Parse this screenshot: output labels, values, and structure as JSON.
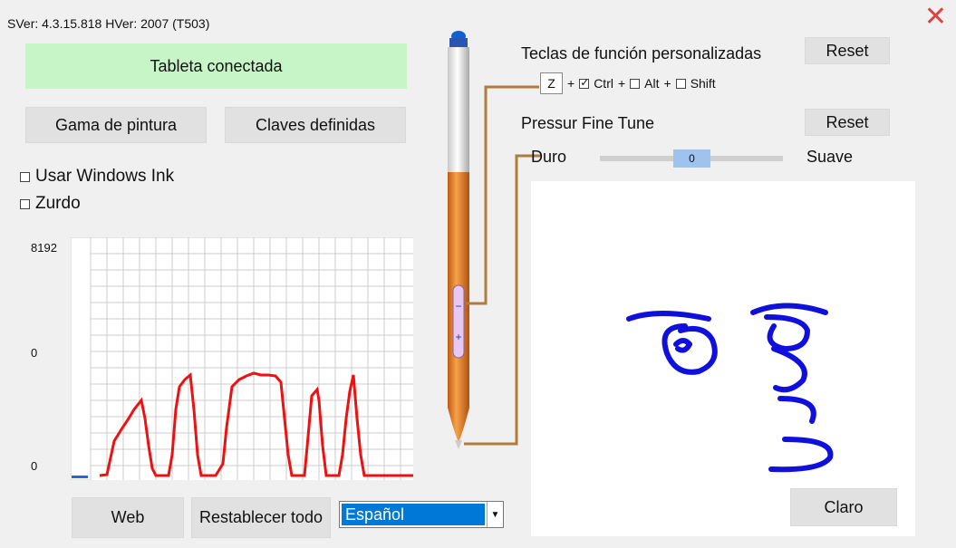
{
  "header": {
    "version_text": "SVer: 4.3.15.818  HVer: 2007  (T503)",
    "close_glyph": "✕"
  },
  "status": {
    "text": "Tableta conectada",
    "color": "#c8f5c8"
  },
  "buttons": {
    "paint_range": "Gama de pintura",
    "defined_keys": "Claves definidas",
    "web": "Web",
    "reset_all": "Restablecer todo",
    "reset_fkeys": "Reset",
    "reset_pressure": "Reset",
    "clear": "Claro"
  },
  "options": [
    {
      "label": "Usar Windows Ink",
      "checked": false
    },
    {
      "label": "Zurdo",
      "checked": false
    }
  ],
  "pressure_graph": {
    "y_labels": [
      "8192",
      "0",
      "0"
    ],
    "grid_color": "#cccccc",
    "line_color": "#ee1111",
    "indicator_color": "#1a6fd6"
  },
  "function_keys": {
    "title": "Teclas de función personalizadas",
    "key": "Z",
    "modifiers": [
      {
        "label": "Ctrl",
        "checked": true
      },
      {
        "label": "Alt",
        "checked": false
      },
      {
        "label": "Shift",
        "checked": false
      }
    ]
  },
  "pressure_tune": {
    "title": "Pressur Fine Tune",
    "left_label": "Duro",
    "right_label": "Suave",
    "value": "0"
  },
  "language": {
    "selected": "Español"
  },
  "pen": {
    "minus": "−",
    "plus": "+",
    "accent": "#e07820",
    "ink": "#1010dd"
  }
}
